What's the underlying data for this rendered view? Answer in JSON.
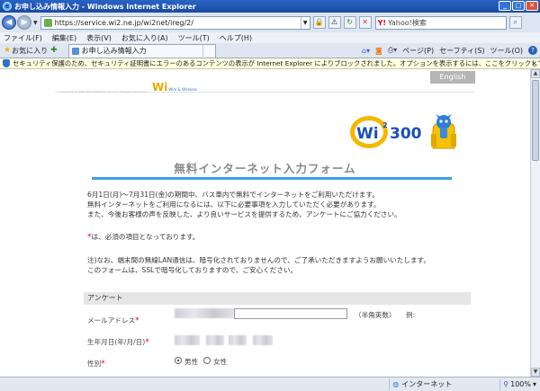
{
  "window": {
    "title": "お申し込み情報入力 - Windows Internet Explorer",
    "min": "_",
    "max": "□",
    "close": "✕"
  },
  "address_bar": {
    "url": "https://service.wi2.ne.jp/wi2net/ireg/2/",
    "search_placeholder": "Yahoo!検索",
    "search_brand": "Y!"
  },
  "menu": [
    "ファイル(F)",
    "編集(E)",
    "表示(V)",
    "お気に入り(A)",
    "ツール(T)",
    "ヘルプ(H)"
  ],
  "favorites_label": "お気に入り",
  "tab": {
    "label": "お申し込み情報入力"
  },
  "commands": {
    "page": "ページ(P)",
    "safety": "セーフティ(S)",
    "tools": "ツール(O)"
  },
  "info_bar": {
    "text": "セキュリティ保護のため、セキュリティ証明書にエラーのあるコンテンツの表示が Internet Explorer によりブロックされました。オプションを表示するには、ここをクリックしてください...",
    "close": "×"
  },
  "site": {
    "copyright": "Copyright © WIRE AND WIRELESS CO.,LTD. All Rights Reserved.",
    "small_logo": "Wi",
    "small_logo_sub": "Wire & Wireless",
    "english_button": "English",
    "logo_wi": "Wi",
    "logo_sup": "2",
    "logo_num": "300"
  },
  "form": {
    "title": "無料インターネット入力フォーム",
    "intro": [
      "6月1日(月)〜7月31日(金)の期間中、バス車内で無料でインターネットをご利用いただけます。",
      "無料インターネットをご利用になるには、以下に必要事項を入力していただく必要があります。",
      "また、今後お客様の声を反映した、より良いサービスを提供するため、アンケートにご協力ください。"
    ],
    "required_mark": "*",
    "required_text": "は、必須の項目となっております。",
    "note": [
      "注)なお、端末間の無線LAN通信は、暗号化されておりませんので、ご了承いただきますようお願いいたします。",
      "このフォームは、SSLで暗号化しておりますので、ご安心ください。"
    ],
    "section_title": "アンケート",
    "email_label": "メールアドレス",
    "email_hint": "（半角英数）",
    "email_example": "例:",
    "birthday_label": "生年月日(年/月/日)",
    "gender_label": "性別",
    "gender_options": [
      "男性",
      "女性"
    ],
    "gender_selected": "男性"
  },
  "status_bar": {
    "zone": "インターネット",
    "zoom": "100%"
  }
}
